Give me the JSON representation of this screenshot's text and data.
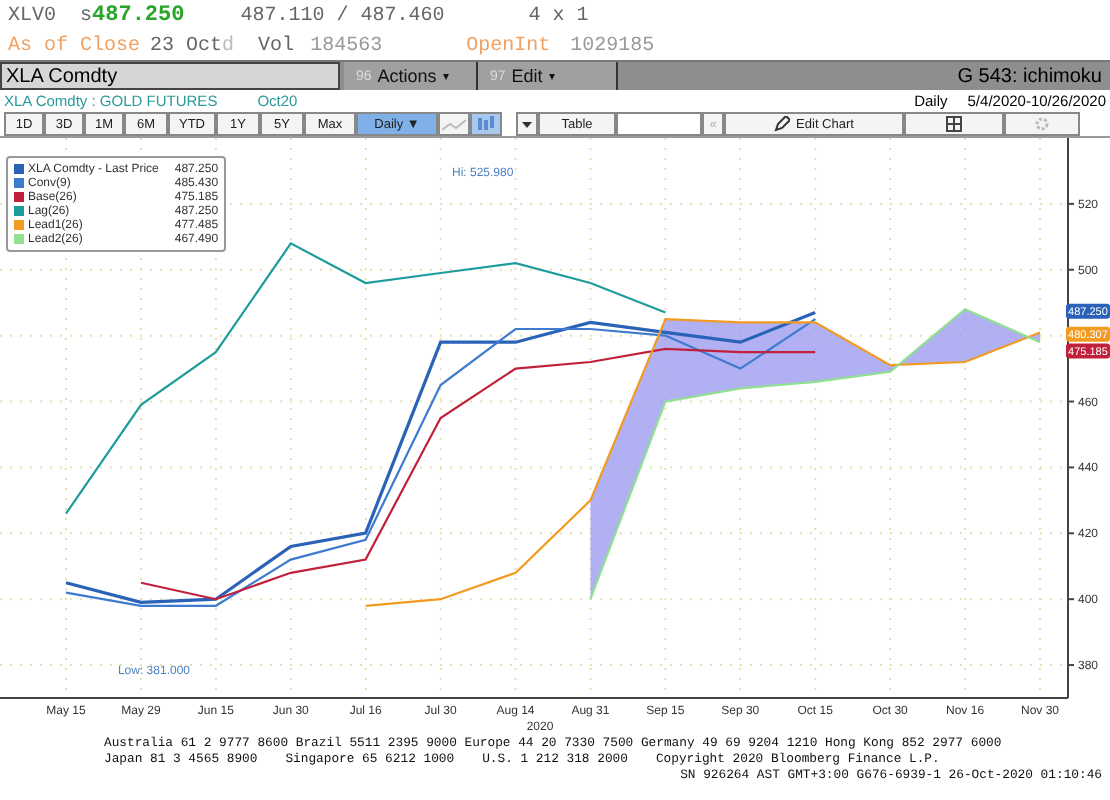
{
  "quote": {
    "ticker": "XLV0",
    "prefix": "s",
    "last": "487.250",
    "bid_ask": "487.110 / 487.460",
    "size": "4 x 1"
  },
  "close_line": {
    "label": "As of Close",
    "date": "23 Oct",
    "flag": "d",
    "vol_label": "Vol",
    "vol": "184563",
    "oi_label": "OpenInt",
    "oi": "1029185"
  },
  "command_bar": {
    "security": "XLA Comdty",
    "menus": [
      {
        "num": "96",
        "label": "Actions",
        "caret": "▾"
      },
      {
        "num": "97",
        "label": "Edit",
        "caret": "▾"
      }
    ],
    "page": "G 543: ichimoku"
  },
  "chart_header": {
    "title": "XLA Comdty : GOLD FUTURES",
    "contract": "Oct20",
    "period": "Daily",
    "range": "5/4/2020-10/26/2020"
  },
  "toolbar": {
    "ranges": [
      {
        "label": "1D",
        "selected": false
      },
      {
        "label": "3D",
        "selected": false
      },
      {
        "label": "1M",
        "selected": false
      },
      {
        "label": "6M",
        "selected": false
      },
      {
        "label": "YTD",
        "selected": false
      },
      {
        "label": "1Y",
        "selected": false
      },
      {
        "label": "5Y",
        "selected": false
      },
      {
        "label": "Max",
        "selected": false
      }
    ],
    "frequency": "Daily ▼",
    "table": "Table",
    "back": "«",
    "edit_chart": "Edit Chart"
  },
  "legend_values": [
    "487.250",
    "485.430",
    "475.185",
    "487.250",
    "477.485",
    "467.490"
  ],
  "extreme_labels": [
    "Hi: 525.980",
    "Low: 381.000"
  ],
  "chart_data": {
    "type": "line",
    "categories": [
      "May 15",
      "May 29",
      "Jun 15",
      "Jun 30",
      "Jul 16",
      "Jul 30",
      "Aug 14",
      "Aug 31",
      "Sep 15",
      "Sep 30",
      "Oct 15",
      "Oct 30",
      "Nov 16",
      "Nov 30"
    ],
    "xlabel": "2020",
    "ylim": [
      370,
      540
    ],
    "yticks": [
      380,
      400,
      420,
      440,
      460,
      500,
      520
    ],
    "grid": true,
    "series": [
      {
        "name": "XLA Comdty - Last Price",
        "color": "#2a62b8",
        "values": [
          405,
          399,
          400,
          416,
          420,
          478,
          478,
          484,
          481,
          478,
          487,
          null,
          null,
          null
        ]
      },
      {
        "name": "Conv(9)",
        "color": "#3d7ad0",
        "values": [
          402,
          398,
          398,
          412,
          418,
          465,
          482,
          482,
          480,
          470,
          485,
          null,
          null,
          null
        ]
      },
      {
        "name": "Base(26)",
        "color": "#c0203a",
        "values": [
          null,
          405,
          400,
          408,
          412,
          455,
          470,
          472,
          476,
          475,
          475,
          null,
          null,
          null
        ]
      },
      {
        "name": "Lag(26)",
        "color": "#1e9c9c",
        "values": [
          426,
          459,
          475,
          508,
          496,
          499,
          502,
          496,
          487,
          null,
          null,
          null,
          null,
          null
        ]
      },
      {
        "name": "Lead1(26)",
        "color": "#f39a20",
        "values": [
          null,
          null,
          null,
          null,
          398,
          400,
          408,
          430,
          485,
          484,
          484,
          471,
          472,
          481
        ]
      },
      {
        "name": "Lead2(26)",
        "color": "#90e090",
        "values": [
          null,
          null,
          null,
          null,
          null,
          null,
          null,
          400,
          460,
          464,
          466,
          469,
          488,
          478
        ]
      }
    ]
  },
  "price_tags": [
    {
      "text": "487.250",
      "color": "#2a62b8"
    },
    {
      "text": "480.307",
      "color": "#f39a20"
    },
    {
      "text": "475.185",
      "color": "#c0203a"
    }
  ],
  "footer": {
    "line1": "Australia 61 2 9777 8600 Brazil 5511 2395 9000 Europe 44 20 7330 7500 Germany 49 69 9204 1210 Hong Kong 852 2977 6000",
    "line2": [
      "Japan 81 3 4565 8900",
      "Singapore 65 6212 1000",
      "U.S. 1 212 318 2000",
      "Copyright 2020 Bloomberg Finance L.P."
    ],
    "line3": "SN 926264 AST GMT+3:00 G676-6939-1 26-Oct-2020 01:10:46"
  }
}
